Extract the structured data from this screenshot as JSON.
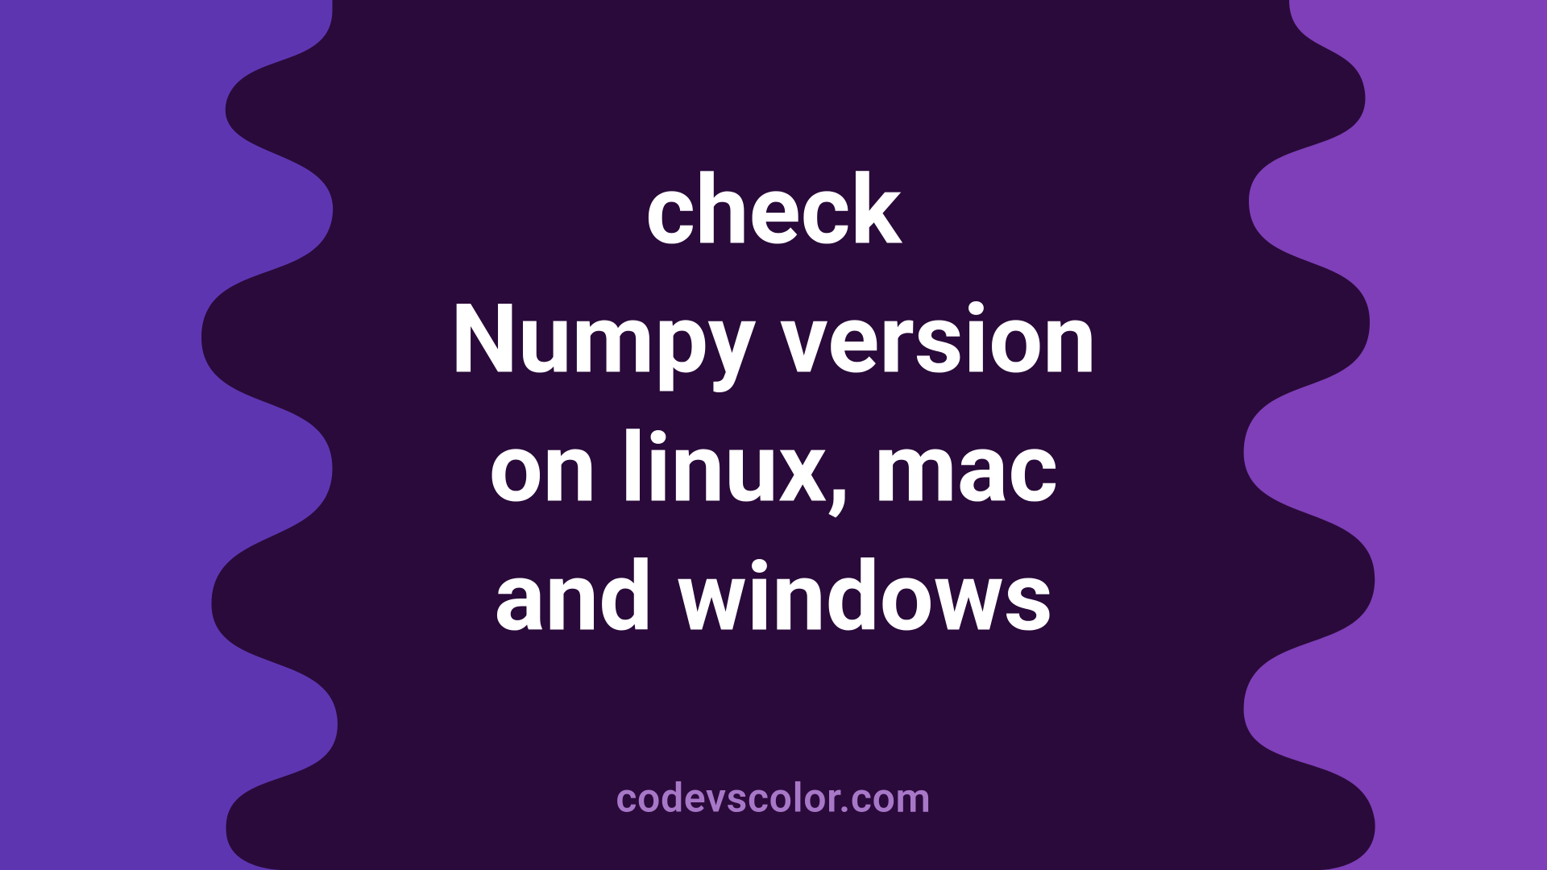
{
  "title_lines": [
    "check",
    "Numpy version",
    "on linux, mac",
    "and windows"
  ],
  "watermark": "codevscolor.com",
  "colors": {
    "bg_left": "#5e35b1",
    "bg_right": "#7e3fb8",
    "blob": "#2a0a3a",
    "text": "#ffffff",
    "watermark": "#a878c8"
  }
}
